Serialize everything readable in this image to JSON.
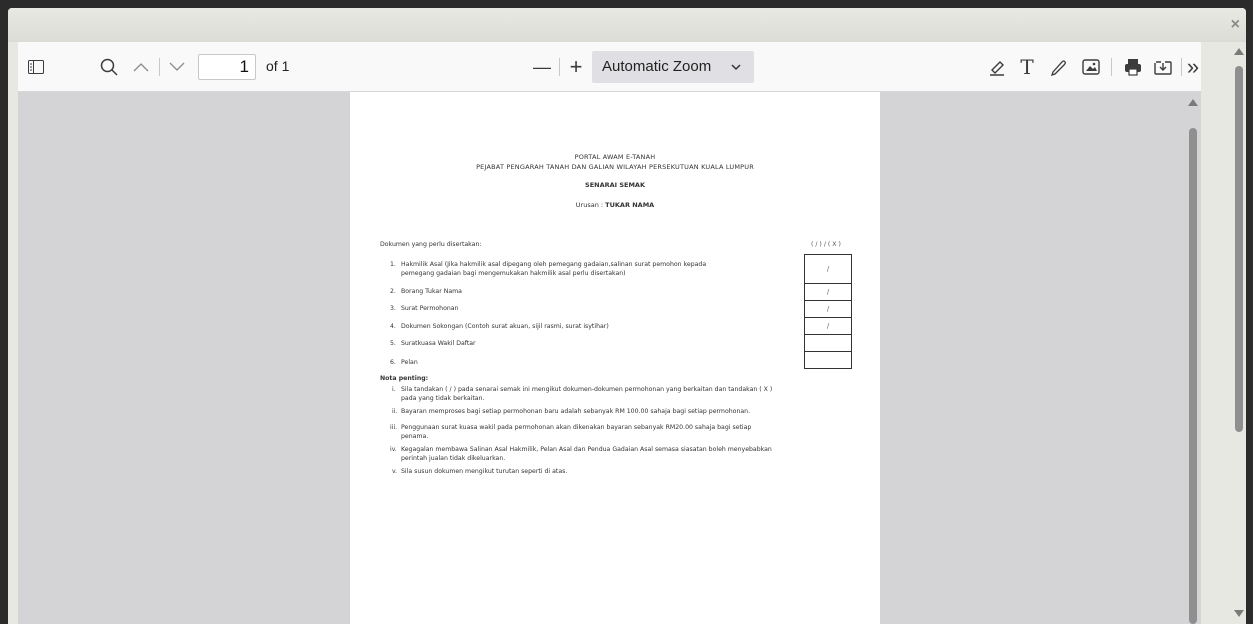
{
  "modal": {
    "close_label": "×"
  },
  "toolbar": {
    "page_number": "1",
    "page_total_label": "of 1",
    "zoom_value": "Automatic Zoom",
    "zoom_out_label": "—",
    "zoom_in_label": "+",
    "text_tool_label": "T",
    "more_tools_label": "»"
  },
  "document": {
    "title_line1": "PORTAL AWAM E-TANAH",
    "title_line2": "PEJABAT PENGARAH TANAH DAN GALIAN WILAYAH PERSEKUTUAN KUALA LUMPUR",
    "heading": "SENARAI SEMAK",
    "urusan_label": "Urusan : ",
    "urusan_value": "TUKAR NAMA",
    "docs_intro": "Dokumen yang perlu disertakan:",
    "check_header": "( / ) / ( X )",
    "items": [
      {
        "num": "1.",
        "line1": "Hakmilik Asal (Jika hakmilik asal dipegang oleh pemegang gadaian,salinan surat pemohon kepada",
        "line2": "pemegang gadaian bagi mengemukakan hakmilik asal perlu disertakan)",
        "mark": "/"
      },
      {
        "num": "2.",
        "line1": "Borang Tukar Nama",
        "mark": "/"
      },
      {
        "num": "3.",
        "line1": "Surat Permohonan",
        "mark": "/"
      },
      {
        "num": "4.",
        "line1": "Dokumen Sokongan (Contoh surat akuan, sijil rasmi, surat isytihar)",
        "mark": "/"
      },
      {
        "num": "5.",
        "line1": "Suratkuasa Wakil Daftar",
        "mark": ""
      },
      {
        "num": "6.",
        "line1": "Pelan",
        "mark": ""
      }
    ],
    "nota_heading": "Nota penting:",
    "notes": [
      {
        "num": "i.",
        "line1": "Sila tandakan ( / ) pada senarai semak ini mengikut dokumen-dokumen permohonan yang berkaitan dan tandakan ( X )",
        "line2": "pada yang tidak berkaitan."
      },
      {
        "num": "ii.",
        "line1": "Bayaran memproses bagi setiap permohonan baru adalah sebanyak RM 100.00 sahaja bagi setiap permohonan."
      },
      {
        "num": "iii.",
        "line1": "Penggunaan surat kuasa wakil pada permohonan akan dikenakan bayaran sebanyak RM20.00 sahaja bagi setiap",
        "line2": "penama."
      },
      {
        "num": "iv.",
        "line1": "Kegagalan membawa Salinan Asal Hakmilik, Pelan Asal dan Pendua Gadaian Asal semasa siasatan boleh menyebabkan",
        "line2": "perintah jualan tidak dikeluarkan."
      },
      {
        "num": "v.",
        "line1": "Sila susun dokumen mengikut turutan seperti di atas."
      }
    ]
  }
}
